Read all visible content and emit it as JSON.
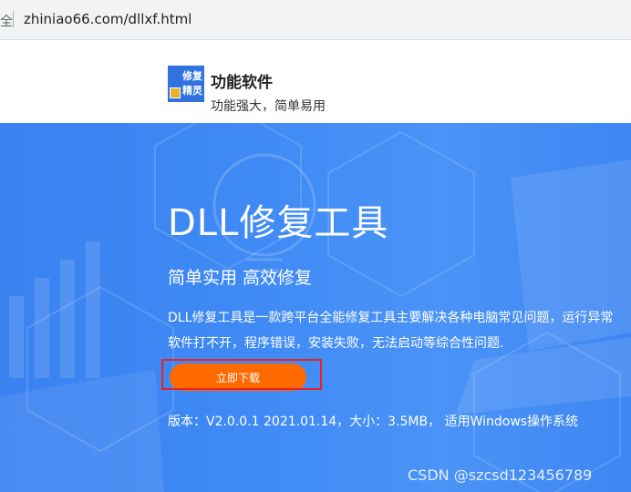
{
  "address_bar": {
    "security_text": "全",
    "url": "zhiniao66.com/dllxf.html"
  },
  "header": {
    "logo_text": "修复精灵",
    "brand_name": "功能软件",
    "slogan": "功能强大，简单易用"
  },
  "hero": {
    "title": "DLL修复工具",
    "subtitle": "简单实用 高效修复",
    "description_line1": "DLL修复工具是一款跨平台全能修复工具主要解决各种电脑常见问题，运行异常",
    "description_line2": "软件打不开，程序错误，安装失败，无法启动等综合性问题.",
    "download_label": "立即下载",
    "version_info": "版本：V2.0.0.1 2021.01.14，大小：3.5MB， 适用Windows操作系统"
  },
  "watermark": "CSDN @szcsd123456789",
  "colors": {
    "hero_blue": "#3f8af5",
    "button_orange": "#ff6a00",
    "highlight_red": "#e8231d",
    "logo_blue": "#2f72e0"
  }
}
